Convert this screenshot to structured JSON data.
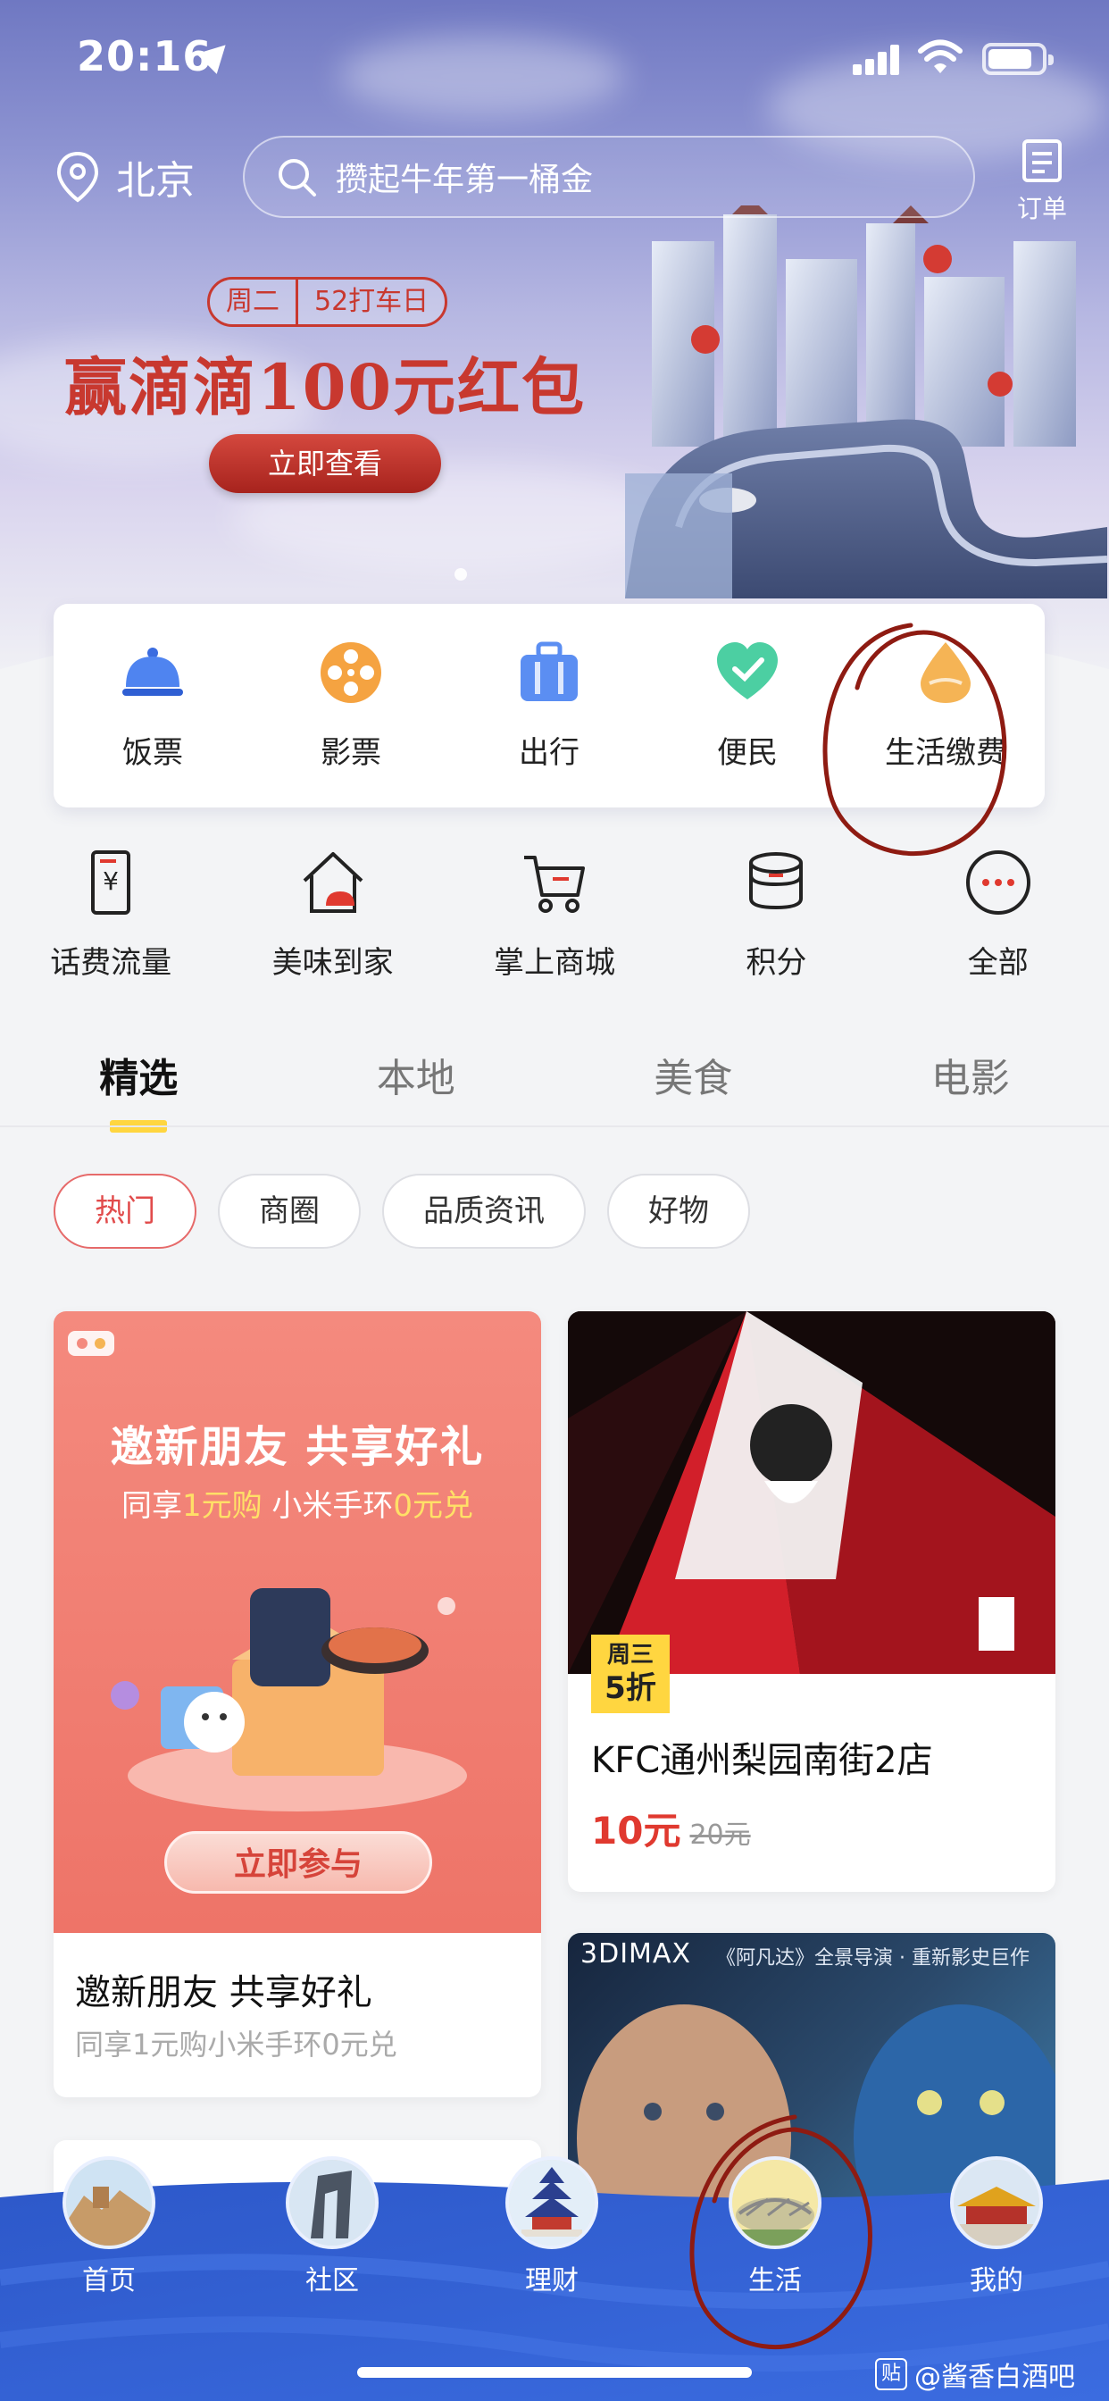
{
  "status_bar": {
    "time": "20:16"
  },
  "header": {
    "location": "北京",
    "search_placeholder": "攒起牛年第一桶金",
    "orders_label": "订单"
  },
  "banner": {
    "tag_day": "周二",
    "tag_event": "52打车日",
    "title": "赢滴滴100元红包",
    "button": "立即查看"
  },
  "services": [
    {
      "label": "饭票",
      "icon": "food-bell-icon"
    },
    {
      "label": "影票",
      "icon": "film-reel-icon"
    },
    {
      "label": "出行",
      "icon": "luggage-icon"
    },
    {
      "label": "便民",
      "icon": "heart-check-icon"
    },
    {
      "label": "生活缴费",
      "icon": "water-drop-icon"
    }
  ],
  "secondary": [
    {
      "label": "话费流量",
      "icon": "phone-bill-icon"
    },
    {
      "label": "美味到家",
      "icon": "home-dish-icon"
    },
    {
      "label": "掌上商城",
      "icon": "cart-icon"
    },
    {
      "label": "积分",
      "icon": "coins-icon"
    },
    {
      "label": "全部",
      "icon": "more-dots-icon"
    }
  ],
  "tabs": [
    {
      "label": "精选",
      "active": true
    },
    {
      "label": "本地",
      "active": false
    },
    {
      "label": "美食",
      "active": false
    },
    {
      "label": "电影",
      "active": false
    }
  ],
  "chips": [
    {
      "label": "热门",
      "active": true
    },
    {
      "label": "商圈",
      "active": false
    },
    {
      "label": "品质资讯",
      "active": false
    },
    {
      "label": "好物",
      "active": false
    }
  ],
  "cards": {
    "invite": {
      "headline": "邀新朋友 共享好礼",
      "sub_prefix": "同享",
      "sub_hl1": "1元购",
      "sub_mid": " 小米手环",
      "sub_hl2": "0元兑",
      "button": "立即参与",
      "title": "邀新朋友 共享好礼",
      "subtitle": "同享1元购小米手环0元兑"
    },
    "kfc": {
      "badge_day": "周三",
      "badge_discount": "5折",
      "title": "KFC通州梨园南街2店",
      "price_now": "10元",
      "price_old": "20元"
    },
    "movie": {
      "tag": "3DIMAX",
      "sub": "《阿凡达》全景导演 · 重新影史巨作"
    }
  },
  "bottom_nav": [
    {
      "label": "首页",
      "icon": "great-wall-icon"
    },
    {
      "label": "社区",
      "icon": "cctv-tower-icon"
    },
    {
      "label": "理财",
      "icon": "temple-of-heaven-icon"
    },
    {
      "label": "生活",
      "icon": "bird-nest-icon"
    },
    {
      "label": "我的",
      "icon": "forbidden-city-icon"
    }
  ],
  "watermark": "@酱香白酒吧",
  "colors": {
    "accent_red": "#c8382f",
    "tab_highlight": "#ffd640",
    "nav_blue": "#2f5fd3"
  }
}
